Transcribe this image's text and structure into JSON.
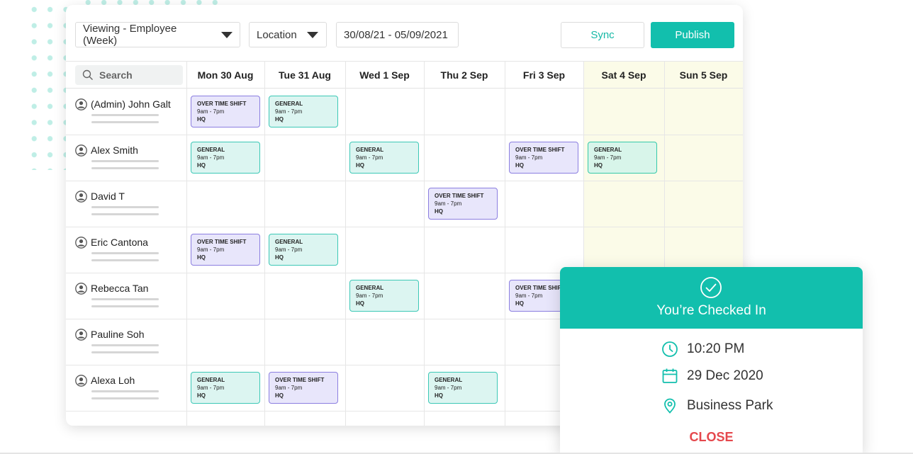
{
  "toolbar": {
    "view_select": "Viewing - Employee (Week)",
    "location_select": "Location",
    "date_range": "30/08/21 - 05/09/2021",
    "sync_label": "Sync",
    "publish_label": "Publish"
  },
  "search": {
    "placeholder": "Search",
    "icon": "search-icon"
  },
  "days": [
    "Mon 30 Aug",
    "Tue 31 Aug",
    "Wed 1 Sep",
    "Thu 2 Sep",
    "Fri 3 Sep",
    "Sat 4 Sep",
    "Sun 5 Sep"
  ],
  "employees": [
    {
      "name": "(Admin) John Galt"
    },
    {
      "name": "Alex Smith"
    },
    {
      "name": "David T"
    },
    {
      "name": "Eric Cantona"
    },
    {
      "name": "Rebecca Tan"
    },
    {
      "name": "Pauline Soh"
    },
    {
      "name": "Alexa Loh"
    }
  ],
  "shift_types": {
    "overtime": "OVER TIME SHIFT",
    "general": "GENERAL",
    "time": "9am - 7pm",
    "location": "HQ"
  },
  "shifts": [
    {
      "row": 0,
      "col": 0,
      "type": "overtime"
    },
    {
      "row": 0,
      "col": 1,
      "type": "general"
    },
    {
      "row": 1,
      "col": 0,
      "type": "general"
    },
    {
      "row": 1,
      "col": 2,
      "type": "general"
    },
    {
      "row": 1,
      "col": 4,
      "type": "overtime"
    },
    {
      "row": 1,
      "col": 5,
      "type": "general"
    },
    {
      "row": 2,
      "col": 3,
      "type": "overtime"
    },
    {
      "row": 3,
      "col": 0,
      "type": "overtime"
    },
    {
      "row": 3,
      "col": 1,
      "type": "general"
    },
    {
      "row": 4,
      "col": 2,
      "type": "general"
    },
    {
      "row": 4,
      "col": 4,
      "type": "overtime"
    },
    {
      "row": 6,
      "col": 0,
      "type": "general"
    },
    {
      "row": 6,
      "col": 1,
      "type": "overtime"
    },
    {
      "row": 6,
      "col": 3,
      "type": "general"
    }
  ],
  "popup": {
    "title": "You’re Checked In",
    "time": "10:20 PM",
    "date": "29 Dec 2020",
    "place": "Business Park",
    "close_label": "CLOSE"
  },
  "colors": {
    "accent": "#12bfad",
    "overtime_bg": "#e8e6fb",
    "overtime_border": "#8b7ee0",
    "general_bg": "#dcf5f1",
    "general_border": "#3cc8b6",
    "weekend_bg": "#fbfbe8",
    "close": "#e5484d"
  }
}
